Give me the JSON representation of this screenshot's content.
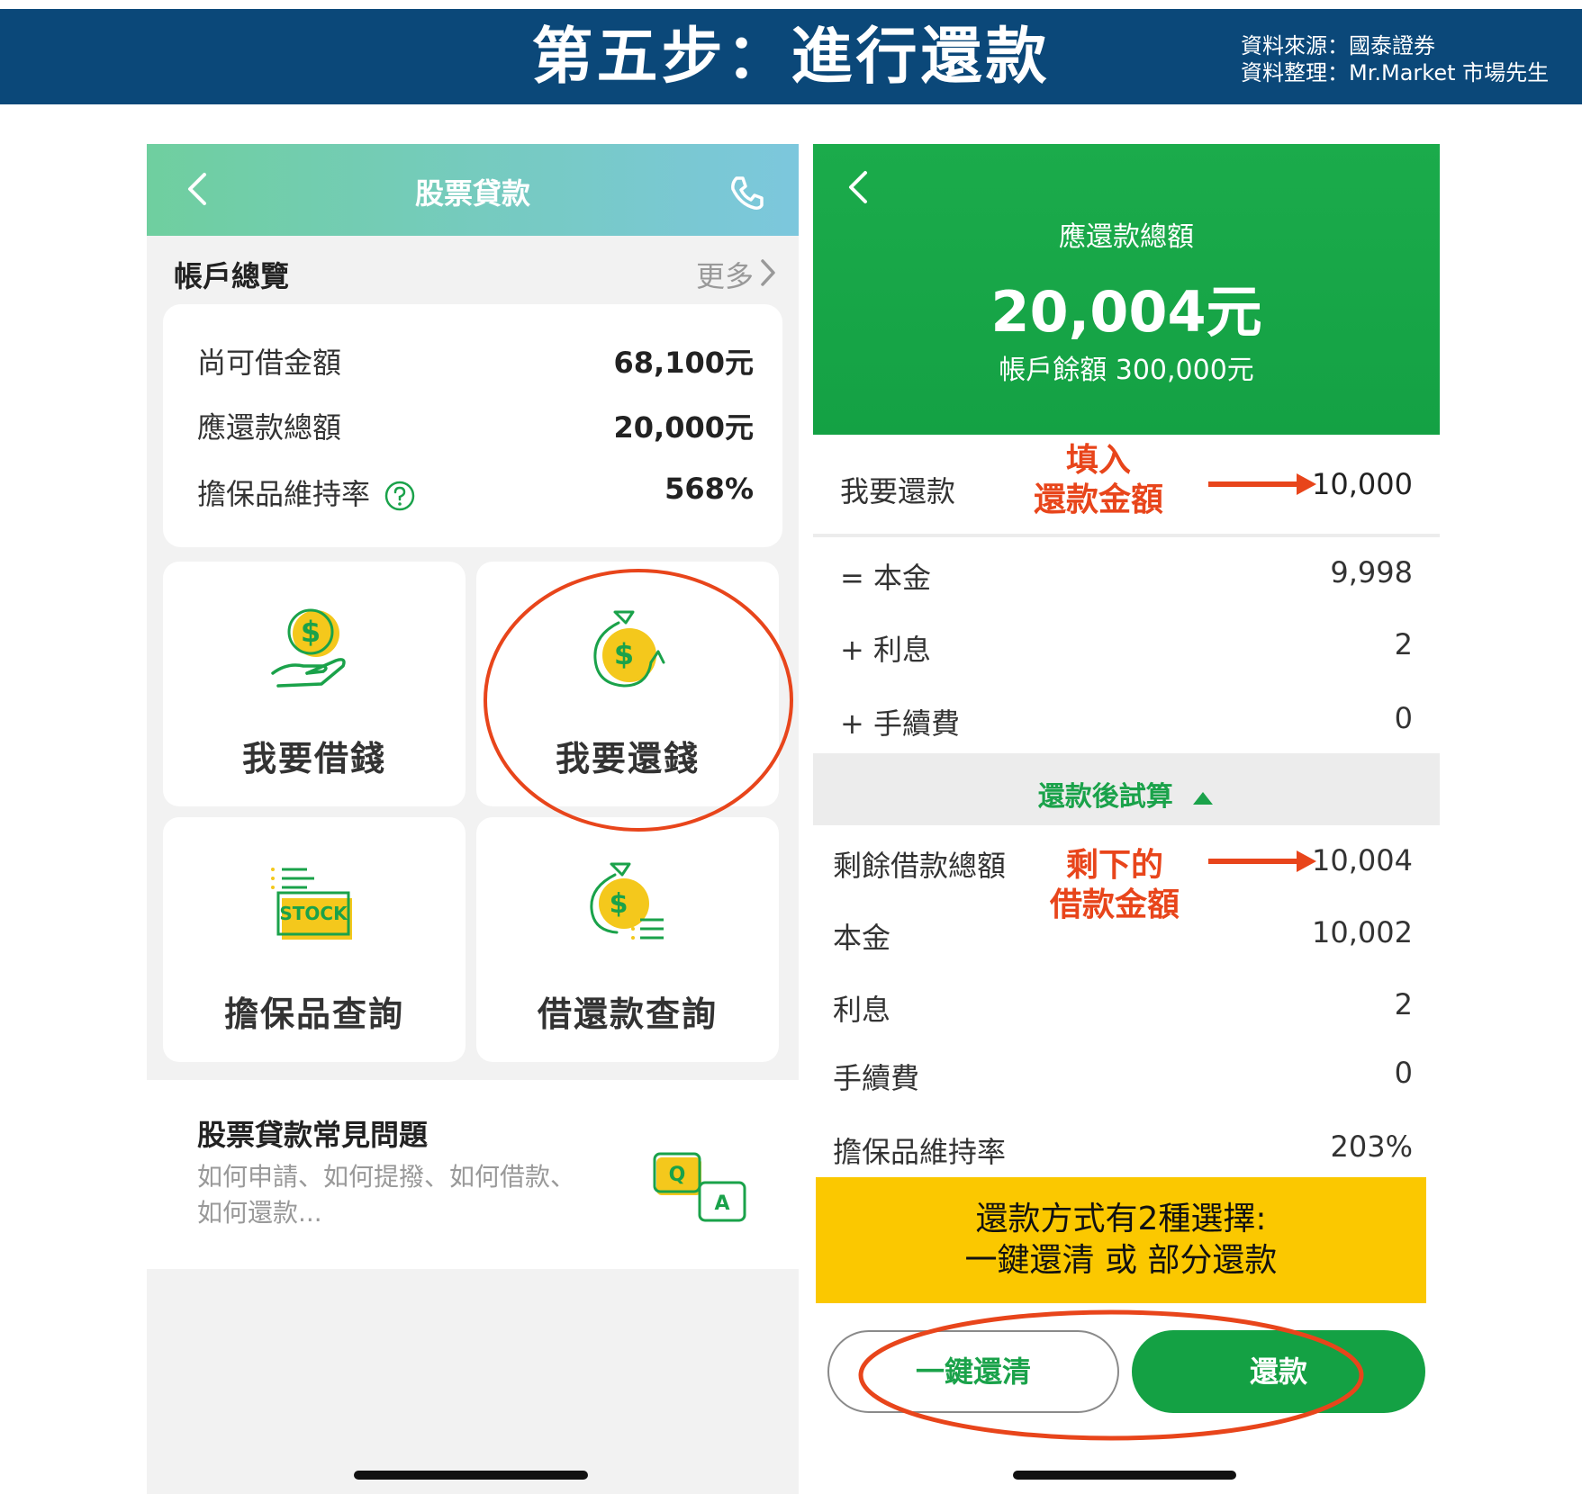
{
  "banner": {
    "title": "第五步：進行還款",
    "source_line1": "資料來源：國泰證券",
    "source_line2": "資料整理：Mr.Market 市場先生"
  },
  "left": {
    "nav_title": "股票貸款",
    "overview_title": "帳戶總覽",
    "more_label": "更多",
    "summary": [
      {
        "label": "尚可借金額",
        "value": "68,100元"
      },
      {
        "label": "應還款總額",
        "value": "20,000元"
      },
      {
        "label": "擔保品維持率",
        "value": "568%"
      }
    ],
    "tiles": {
      "borrow": "我要借錢",
      "repay": "我要還錢",
      "collateral": "擔保品查詢",
      "history": "借還款查詢",
      "stock_badge": "STOCK"
    },
    "faq": {
      "title": "股票貸款常見問題",
      "desc": "如何申請、如何提撥、如何借款、如何還款...",
      "q": "Q",
      "a": "A"
    }
  },
  "right": {
    "header": {
      "label": "應還款總額",
      "amount": "20,004元",
      "balance": "帳戶餘額 300,000元"
    },
    "input": {
      "label": "我要還款",
      "value": "10,000"
    },
    "breakdown": [
      {
        "label": "= 本金",
        "value": "9,998"
      },
      {
        "label": "+ 利息",
        "value": "2"
      },
      {
        "label": "+ 手續費",
        "value": "0"
      }
    ],
    "toggle_label": "還款後試算",
    "after": [
      {
        "label": "剩餘借款總額",
        "value": "10,004"
      },
      {
        "label": "本金",
        "value": "10,002"
      },
      {
        "label": "利息",
        "value": "2"
      },
      {
        "label": "手續費",
        "value": "0"
      },
      {
        "label": "擔保品維持率",
        "value": "203%"
      }
    ],
    "yellow_note_line1": "還款方式有2種選擇:",
    "yellow_note_line2": "一鍵還清 或 部分還款",
    "btn_clear": "一鍵還清",
    "btn_repay": "還款"
  },
  "annotations": {
    "fill_amount_line1": "填入",
    "fill_amount_line2": "還款金額",
    "remaining_line1": "剩下的",
    "remaining_line2": "借款金額"
  },
  "colors": {
    "banner": "#0b4879",
    "green": "#14a144",
    "accent_red": "#e8451b",
    "yellow": "#fbc800"
  }
}
